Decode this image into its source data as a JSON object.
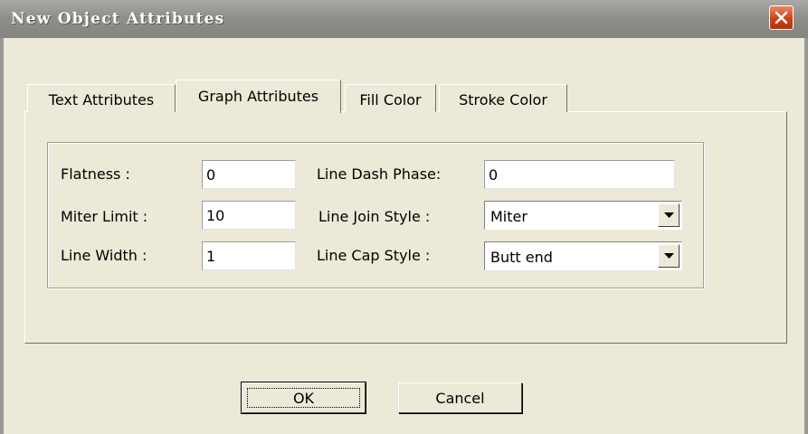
{
  "dialog": {
    "title": "New Object Attributes"
  },
  "tabs": [
    {
      "label": "Text Attributes",
      "selected": false
    },
    {
      "label": "Graph Attributes",
      "selected": true
    },
    {
      "label": "Fill Color",
      "selected": false
    },
    {
      "label": "Stroke Color",
      "selected": false
    }
  ],
  "graph_attributes": {
    "flatness": {
      "label": "Flatness :",
      "value": "0"
    },
    "miter_limit": {
      "label": "Miter Limit :",
      "value": "10"
    },
    "line_width": {
      "label": "Line Width :",
      "value": "1"
    },
    "line_dash_phase": {
      "label": "Line Dash Phase:",
      "value": "0"
    },
    "line_join_style": {
      "label": "Line Join Style :",
      "value": "Miter"
    },
    "line_cap_style": {
      "label": "Line Cap Style :",
      "value": "Butt end"
    }
  },
  "buttons": {
    "ok": "OK",
    "cancel": "Cancel"
  },
  "colors": {
    "dialog_bg": "#ece9d8",
    "titlebar": "#8f8f8b",
    "close_button": "#c9421a"
  }
}
